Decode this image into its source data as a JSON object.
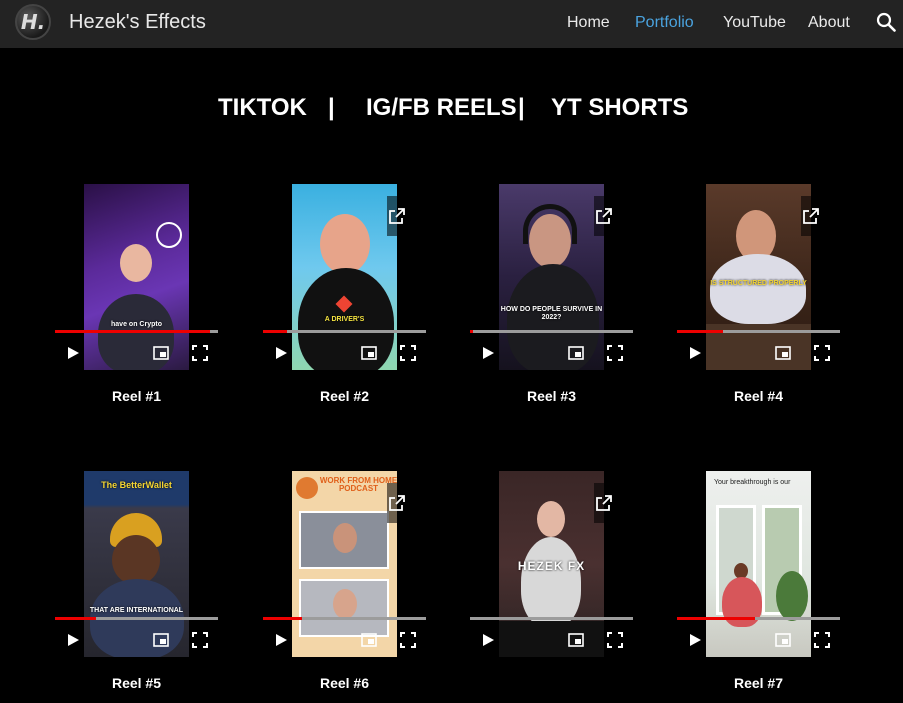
{
  "header": {
    "logo_text": "H.",
    "site_title": "Hezek's Effects",
    "nav": [
      "Home",
      "Portfolio",
      "YouTube",
      "About"
    ],
    "active": "Portfolio"
  },
  "headings": [
    "TIKTOK",
    "|",
    "IG/FB REELS",
    "|",
    "YT SHORTS"
  ],
  "reels": [
    {
      "label": "Reel #1",
      "caption": "have on Crypto",
      "progress": 0.95
    },
    {
      "label": "Reel #2",
      "caption": "A DRIVER'S",
      "progress": 0.15
    },
    {
      "label": "Reel #3",
      "caption": "HOW DO PEOPLE SURVIVE IN 2022?",
      "progress": 0.02
    },
    {
      "label": "Reel #4",
      "caption": "IS STRUCTURED PROPERLY",
      "progress": 0.28
    },
    {
      "label": "Reel #5",
      "caption_top": "The BetterWallet",
      "caption": "THAT ARE INTERNATIONAL",
      "progress": 0.25
    },
    {
      "label": "Reel #6",
      "caption_top": "WORK FROM HOME PODCAST",
      "progress": 0.24
    },
    {
      "caption_top": "HEZEK FX",
      "progress": 0.0
    },
    {
      "label": "Reel #7",
      "caption_top": "Your breakthrough is our",
      "progress": 0.48
    }
  ],
  "colors": {
    "accent": "#4aa3df",
    "progress": "#e00000",
    "header_bg": "#232323"
  }
}
